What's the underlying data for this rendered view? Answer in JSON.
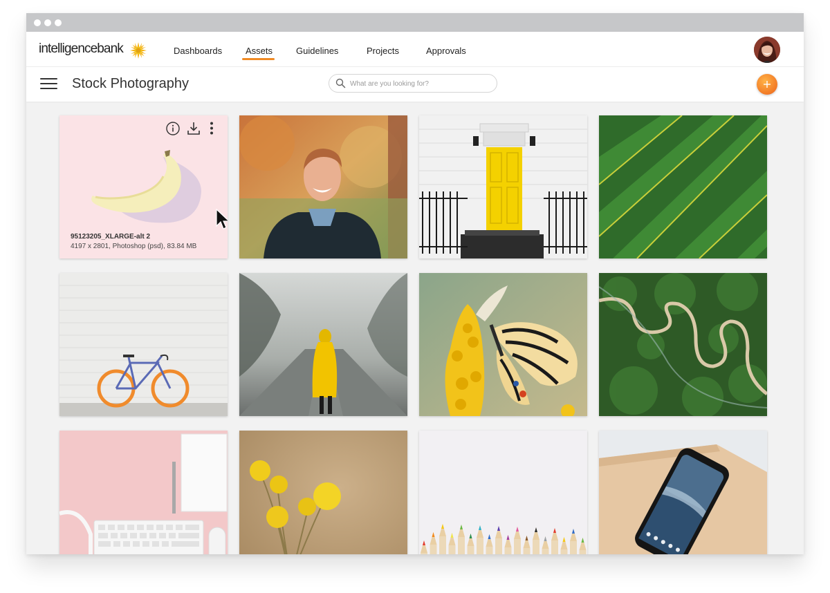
{
  "app": {
    "logo_text": "intelligencebank",
    "nav": [
      {
        "label": "Dashboards"
      },
      {
        "label": "Assets",
        "active": true
      },
      {
        "label": "Guidelines"
      },
      {
        "label": "Projects"
      },
      {
        "label": "Approvals"
      }
    ],
    "accent_color": "#f08a24"
  },
  "header": {
    "title": "Stock Photography",
    "search": {
      "placeholder": "What are you looking for?",
      "value": ""
    }
  },
  "grid": {
    "tiles": [
      {
        "subject": "banana",
        "name": "95123205_XLARGE-alt 2",
        "meta": "4197 x 2801, Photoshop (psd), 83.84 MB",
        "hovered": true
      },
      {
        "subject": "smiling man portrait"
      },
      {
        "subject": "yellow door"
      },
      {
        "subject": "palm leaf"
      },
      {
        "subject": "bicycle against white brick wall"
      },
      {
        "subject": "person in yellow raincoat in fog"
      },
      {
        "subject": "butterfly on yellow flower"
      },
      {
        "subject": "winding road aerial"
      },
      {
        "subject": "pink desk with keyboard"
      },
      {
        "subject": "yellow flowers"
      },
      {
        "subject": "colored pencils"
      },
      {
        "subject": "smartphone on table"
      }
    ]
  },
  "icons": {
    "info": "info-icon",
    "download": "download-icon",
    "more": "more-vertical-icon",
    "add": "plus-icon",
    "search": "search-icon",
    "menu": "hamburger-menu-icon"
  }
}
